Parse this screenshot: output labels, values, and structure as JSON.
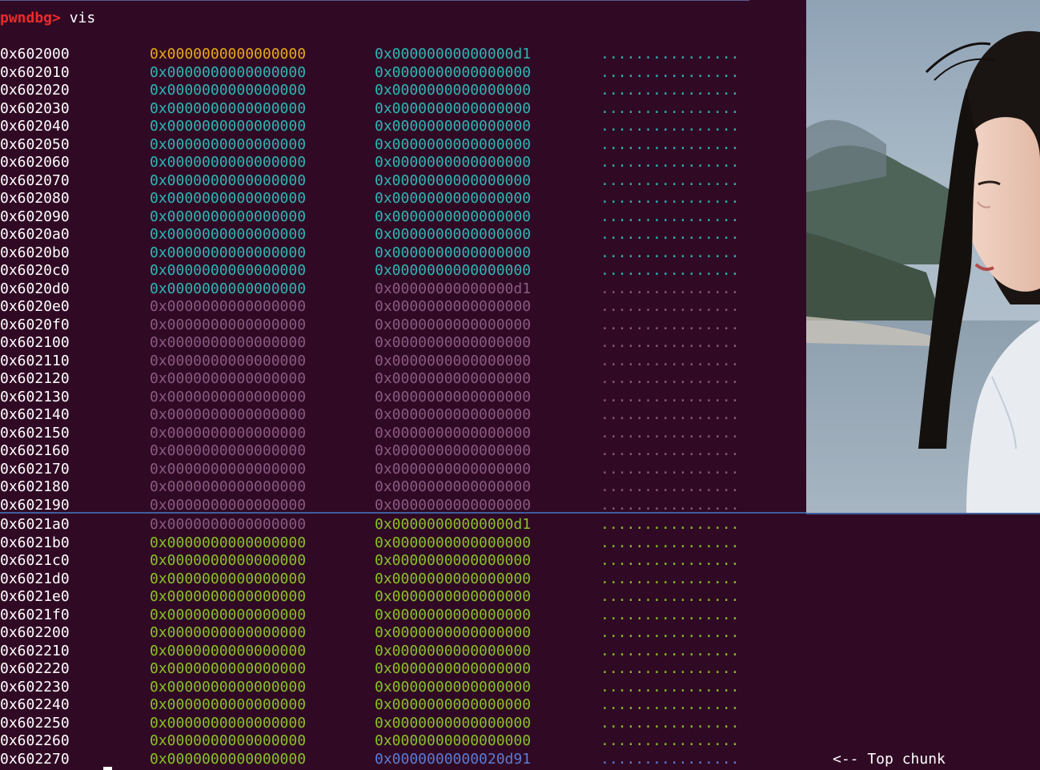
{
  "prompt": {
    "label": "pwndbg>",
    "command": "vis"
  },
  "colors": {
    "background": "#300a24",
    "prompt": "#ef2929",
    "orange": "#e8a81c",
    "cyan": "#2fb5b5",
    "purple": "#8a5a82",
    "green": "#89c02a",
    "blue": "#5c7bd4"
  },
  "rows": [
    {
      "addr": "0x602000",
      "q1": "0x0000000000000000",
      "q2": "0x00000000000000d1",
      "ascii": "................",
      "c1": "orange",
      "c2": "cyan",
      "ca": "cyan"
    },
    {
      "addr": "0x602010",
      "q1": "0x0000000000000000",
      "q2": "0x0000000000000000",
      "ascii": "................",
      "c1": "cyan",
      "c2": "cyan",
      "ca": "cyan"
    },
    {
      "addr": "0x602020",
      "q1": "0x0000000000000000",
      "q2": "0x0000000000000000",
      "ascii": "................",
      "c1": "cyan",
      "c2": "cyan",
      "ca": "cyan"
    },
    {
      "addr": "0x602030",
      "q1": "0x0000000000000000",
      "q2": "0x0000000000000000",
      "ascii": "................",
      "c1": "cyan",
      "c2": "cyan",
      "ca": "cyan"
    },
    {
      "addr": "0x602040",
      "q1": "0x0000000000000000",
      "q2": "0x0000000000000000",
      "ascii": "................",
      "c1": "cyan",
      "c2": "cyan",
      "ca": "cyan"
    },
    {
      "addr": "0x602050",
      "q1": "0x0000000000000000",
      "q2": "0x0000000000000000",
      "ascii": "................",
      "c1": "cyan",
      "c2": "cyan",
      "ca": "cyan"
    },
    {
      "addr": "0x602060",
      "q1": "0x0000000000000000",
      "q2": "0x0000000000000000",
      "ascii": "................",
      "c1": "cyan",
      "c2": "cyan",
      "ca": "cyan"
    },
    {
      "addr": "0x602070",
      "q1": "0x0000000000000000",
      "q2": "0x0000000000000000",
      "ascii": "................",
      "c1": "cyan",
      "c2": "cyan",
      "ca": "cyan"
    },
    {
      "addr": "0x602080",
      "q1": "0x0000000000000000",
      "q2": "0x0000000000000000",
      "ascii": "................",
      "c1": "cyan",
      "c2": "cyan",
      "ca": "cyan"
    },
    {
      "addr": "0x602090",
      "q1": "0x0000000000000000",
      "q2": "0x0000000000000000",
      "ascii": "................",
      "c1": "cyan",
      "c2": "cyan",
      "ca": "cyan"
    },
    {
      "addr": "0x6020a0",
      "q1": "0x0000000000000000",
      "q2": "0x0000000000000000",
      "ascii": "................",
      "c1": "cyan",
      "c2": "cyan",
      "ca": "cyan"
    },
    {
      "addr": "0x6020b0",
      "q1": "0x0000000000000000",
      "q2": "0x0000000000000000",
      "ascii": "................",
      "c1": "cyan",
      "c2": "cyan",
      "ca": "cyan"
    },
    {
      "addr": "0x6020c0",
      "q1": "0x0000000000000000",
      "q2": "0x0000000000000000",
      "ascii": "................",
      "c1": "cyan",
      "c2": "cyan",
      "ca": "cyan"
    },
    {
      "addr": "0x6020d0",
      "q1": "0x0000000000000000",
      "q2": "0x00000000000000d1",
      "ascii": "................",
      "c1": "cyan",
      "c2": "purple",
      "ca": "purple"
    },
    {
      "addr": "0x6020e0",
      "q1": "0x0000000000000000",
      "q2": "0x0000000000000000",
      "ascii": "................",
      "c1": "purple",
      "c2": "purple",
      "ca": "purple"
    },
    {
      "addr": "0x6020f0",
      "q1": "0x0000000000000000",
      "q2": "0x0000000000000000",
      "ascii": "................",
      "c1": "purple",
      "c2": "purple",
      "ca": "purple"
    },
    {
      "addr": "0x602100",
      "q1": "0x0000000000000000",
      "q2": "0x0000000000000000",
      "ascii": "................",
      "c1": "purple",
      "c2": "purple",
      "ca": "purple"
    },
    {
      "addr": "0x602110",
      "q1": "0x0000000000000000",
      "q2": "0x0000000000000000",
      "ascii": "................",
      "c1": "purple",
      "c2": "purple",
      "ca": "purple"
    },
    {
      "addr": "0x602120",
      "q1": "0x0000000000000000",
      "q2": "0x0000000000000000",
      "ascii": "................",
      "c1": "purple",
      "c2": "purple",
      "ca": "purple"
    },
    {
      "addr": "0x602130",
      "q1": "0x0000000000000000",
      "q2": "0x0000000000000000",
      "ascii": "................",
      "c1": "purple",
      "c2": "purple",
      "ca": "purple"
    },
    {
      "addr": "0x602140",
      "q1": "0x0000000000000000",
      "q2": "0x0000000000000000",
      "ascii": "................",
      "c1": "purple",
      "c2": "purple",
      "ca": "purple"
    },
    {
      "addr": "0x602150",
      "q1": "0x0000000000000000",
      "q2": "0x0000000000000000",
      "ascii": "................",
      "c1": "purple",
      "c2": "purple",
      "ca": "purple"
    },
    {
      "addr": "0x602160",
      "q1": "0x0000000000000000",
      "q2": "0x0000000000000000",
      "ascii": "................",
      "c1": "purple",
      "c2": "purple",
      "ca": "purple"
    },
    {
      "addr": "0x602170",
      "q1": "0x0000000000000000",
      "q2": "0x0000000000000000",
      "ascii": "................",
      "c1": "purple",
      "c2": "purple",
      "ca": "purple"
    },
    {
      "addr": "0x602180",
      "q1": "0x0000000000000000",
      "q2": "0x0000000000000000",
      "ascii": "................",
      "c1": "purple",
      "c2": "purple",
      "ca": "purple"
    },
    {
      "addr": "0x602190",
      "q1": "0x0000000000000000",
      "q2": "0x0000000000000000",
      "ascii": "................",
      "c1": "purple",
      "c2": "purple",
      "ca": "purple"
    },
    {
      "addr": "0x6021a0",
      "q1": "0x0000000000000000",
      "q2": "0x00000000000000d1",
      "ascii": "................",
      "c1": "purple",
      "c2": "green",
      "ca": "green"
    },
    {
      "addr": "0x6021b0",
      "q1": "0x0000000000000000",
      "q2": "0x0000000000000000",
      "ascii": "................",
      "c1": "green",
      "c2": "green",
      "ca": "green"
    },
    {
      "addr": "0x6021c0",
      "q1": "0x0000000000000000",
      "q2": "0x0000000000000000",
      "ascii": "................",
      "c1": "green",
      "c2": "green",
      "ca": "green"
    },
    {
      "addr": "0x6021d0",
      "q1": "0x0000000000000000",
      "q2": "0x0000000000000000",
      "ascii": "................",
      "c1": "green",
      "c2": "green",
      "ca": "green"
    },
    {
      "addr": "0x6021e0",
      "q1": "0x0000000000000000",
      "q2": "0x0000000000000000",
      "ascii": "................",
      "c1": "green",
      "c2": "green",
      "ca": "green"
    },
    {
      "addr": "0x6021f0",
      "q1": "0x0000000000000000",
      "q2": "0x0000000000000000",
      "ascii": "................",
      "c1": "green",
      "c2": "green",
      "ca": "green"
    },
    {
      "addr": "0x602200",
      "q1": "0x0000000000000000",
      "q2": "0x0000000000000000",
      "ascii": "................",
      "c1": "green",
      "c2": "green",
      "ca": "green"
    },
    {
      "addr": "0x602210",
      "q1": "0x0000000000000000",
      "q2": "0x0000000000000000",
      "ascii": "................",
      "c1": "green",
      "c2": "green",
      "ca": "green"
    },
    {
      "addr": "0x602220",
      "q1": "0x0000000000000000",
      "q2": "0x0000000000000000",
      "ascii": "................",
      "c1": "green",
      "c2": "green",
      "ca": "green"
    },
    {
      "addr": "0x602230",
      "q1": "0x0000000000000000",
      "q2": "0x0000000000000000",
      "ascii": "................",
      "c1": "green",
      "c2": "green",
      "ca": "green"
    },
    {
      "addr": "0x602240",
      "q1": "0x0000000000000000",
      "q2": "0x0000000000000000",
      "ascii": "................",
      "c1": "green",
      "c2": "green",
      "ca": "green"
    },
    {
      "addr": "0x602250",
      "q1": "0x0000000000000000",
      "q2": "0x0000000000000000",
      "ascii": "................",
      "c1": "green",
      "c2": "green",
      "ca": "green"
    },
    {
      "addr": "0x602260",
      "q1": "0x0000000000000000",
      "q2": "0x0000000000000000",
      "ascii": "................",
      "c1": "green",
      "c2": "green",
      "ca": "green"
    },
    {
      "addr": "0x602270",
      "q1": "0x0000000000000000",
      "q2": "0x0000000000020d91",
      "ascii": "................",
      "c1": "green",
      "c2": "blue",
      "ca": "blue",
      "note": "<-- Top chunk"
    }
  ]
}
